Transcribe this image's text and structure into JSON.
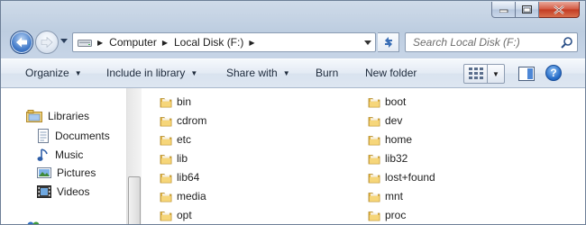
{
  "window": {
    "caption_buttons": [
      "minimize-icon",
      "maximize-icon",
      "close-icon"
    ]
  },
  "address_bar": {
    "drive_icon": "drive-icon",
    "breadcrumbs": [
      "Computer",
      "Local Disk (F:)"
    ]
  },
  "search": {
    "placeholder": "Search Local Disk (F:)",
    "value": ""
  },
  "toolbar": {
    "organize": "Organize",
    "include_in_library": "Include in library",
    "share_with": "Share with",
    "burn": "Burn",
    "new_folder": "New folder"
  },
  "navigation_pane": {
    "items": [
      {
        "label": "Libraries",
        "icon": "libraries-icon"
      },
      {
        "label": "Documents",
        "icon": "documents-icon"
      },
      {
        "label": "Music",
        "icon": "music-icon"
      },
      {
        "label": "Pictures",
        "icon": "pictures-icon"
      },
      {
        "label": "Videos",
        "icon": "videos-icon"
      }
    ]
  },
  "files": {
    "left_column": [
      "bin",
      "cdrom",
      "etc",
      "lib",
      "lib64",
      "media",
      "opt"
    ],
    "right_column": [
      "boot",
      "dev",
      "home",
      "lib32",
      "lost+found",
      "mnt",
      "proc"
    ]
  },
  "colors": {
    "folder": "#f2c94c",
    "frame": "#c6d4e6"
  }
}
